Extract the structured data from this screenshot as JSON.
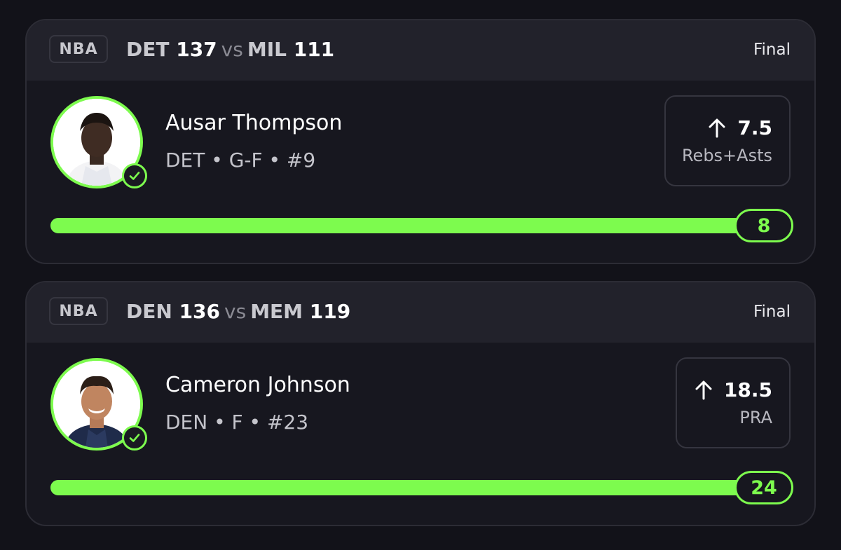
{
  "colors": {
    "background": "#121219",
    "card": "#17171f",
    "header": "#22222b",
    "accent": "#7dfb4e"
  },
  "cards": [
    {
      "league": "NBA",
      "home_team": "DET",
      "home_score": "137",
      "vs": "vs",
      "away_team": "MIL",
      "away_score": "111",
      "status": "Final",
      "player_name": "Ausar Thompson",
      "player_team": "DET",
      "player_position": "G-F",
      "player_number": "#9",
      "meta_sep": "•",
      "direction_icon": "arrow-up-icon",
      "line": "7.5",
      "stat": "Rebs+Asts",
      "result": "8",
      "progress": 1.0,
      "verified_icon": "check-circle-icon"
    },
    {
      "league": "NBA",
      "home_team": "DEN",
      "home_score": "136",
      "vs": "vs",
      "away_team": "MEM",
      "away_score": "119",
      "status": "Final",
      "player_name": "Cameron Johnson",
      "player_team": "DEN",
      "player_position": "F",
      "player_number": "#23",
      "meta_sep": "•",
      "direction_icon": "arrow-up-icon",
      "line": "18.5",
      "stat": "PRA",
      "result": "24",
      "progress": 1.0,
      "verified_icon": "check-circle-icon"
    }
  ]
}
